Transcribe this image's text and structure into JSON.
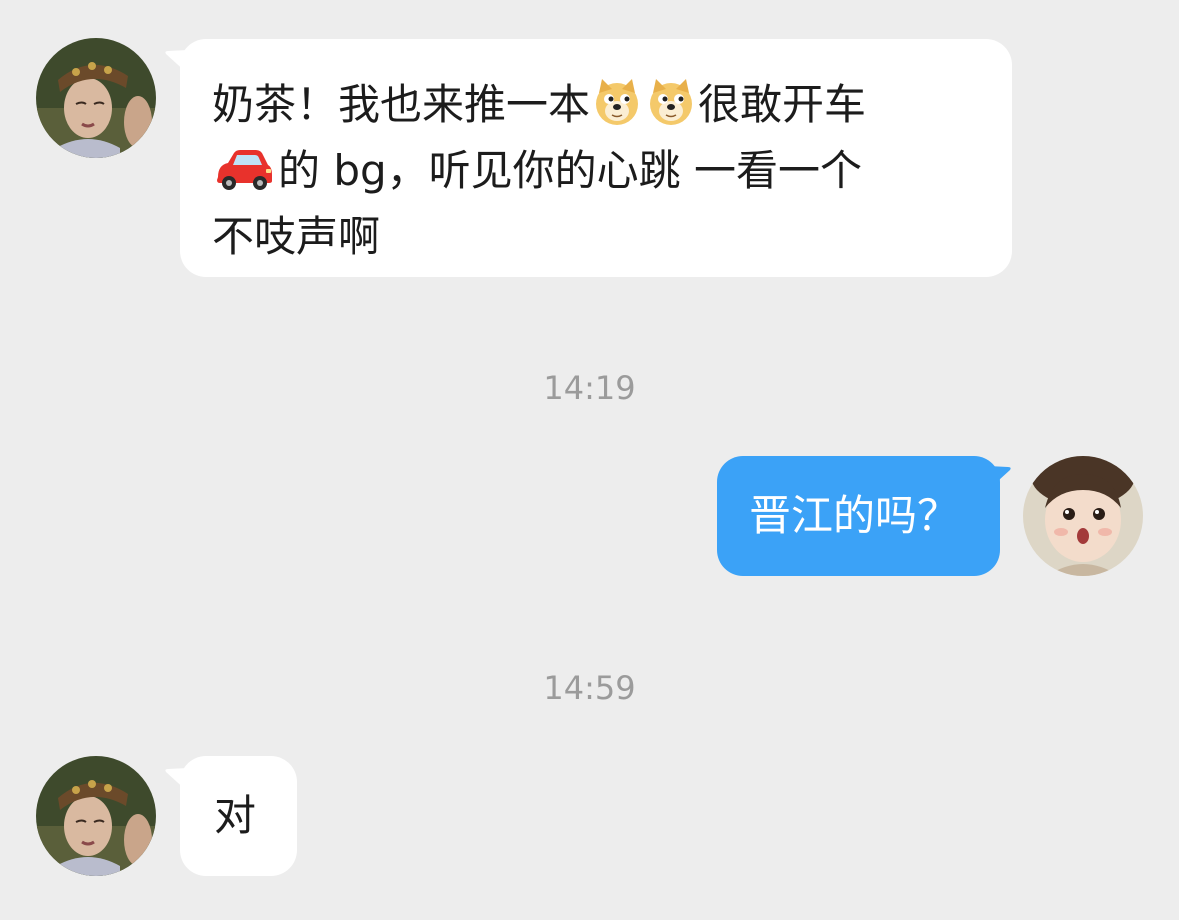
{
  "chat": {
    "messages": [
      {
        "sender": "other",
        "segments": [
          "奶茶！我也来推一本",
          "很敢开车",
          "的 bg，听见你的心跳 一看一个",
          "不吱声啊"
        ],
        "emojis": [
          "doge-icon",
          "doge-icon",
          "car-icon"
        ]
      },
      {
        "type": "timestamp",
        "text": "14:19"
      },
      {
        "sender": "me",
        "text": "晋江的吗？"
      },
      {
        "type": "timestamp",
        "text": "14:59"
      },
      {
        "sender": "other",
        "text": "对"
      }
    ]
  },
  "colors": {
    "background": "#ededed",
    "incoming_bubble": "#ffffff",
    "outgoing_bubble": "#3ba2f7",
    "timestamp_text": "#9b9b9b"
  }
}
